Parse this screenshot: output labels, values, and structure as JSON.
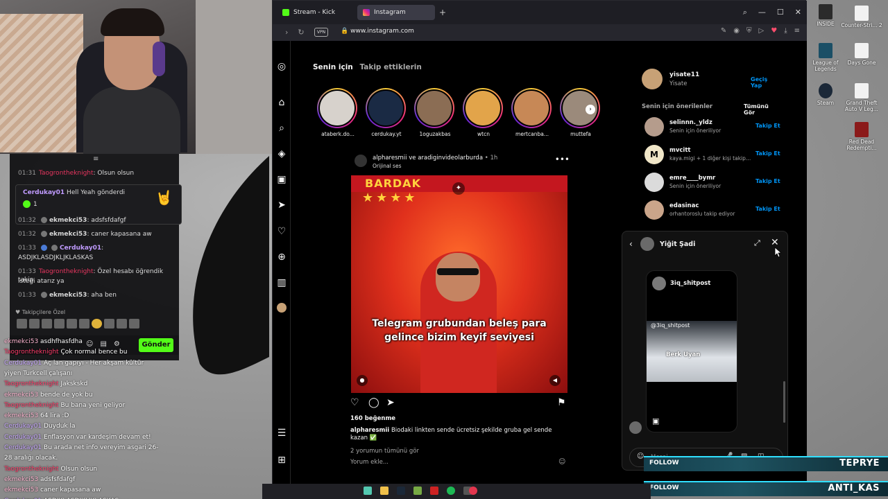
{
  "browser": {
    "tabs": [
      {
        "label": "Stream - Kick Dashboard",
        "icon": "kick-icon",
        "color": "#53fc18",
        "active": false
      },
      {
        "label": "Instagram",
        "icon": "instagram-icon",
        "color": "#e1306c",
        "active": true
      }
    ],
    "url": "www.instagram.com",
    "vpn_label": "VPN"
  },
  "feed": {
    "tab_active": "Senin için",
    "tab_inactive": "Takip ettiklerin",
    "stories": [
      {
        "name": "ataberk.do..."
      },
      {
        "name": "cerdukay.yt"
      },
      {
        "name": "1oguzakbas"
      },
      {
        "name": "wtcn"
      },
      {
        "name": "mertcanba..."
      },
      {
        "name": "muttefa"
      }
    ],
    "post": {
      "users": "alpharesmii ve aradiginvideolarburda",
      "time": "• 1h",
      "audio": "Orijinal ses",
      "banner": "BARDAK",
      "overlay_caption": "Telegram grubundan beleş para gelince bizim keyif seviyesi",
      "likes": "160 beğenme",
      "caption_user": "alpharesmii",
      "caption_text": "Biodaki linkten sende ücretsiz şekilde gruba gel sende kazan ✅",
      "view_comments": "2 yorumun tümünü gör",
      "add_comment": "Yorum ekle..."
    }
  },
  "sidebar": {
    "me": {
      "username": "yisate11",
      "name": "Yisate",
      "switch": "Geçiş Yap"
    },
    "suggestions_title": "Senin için önerilenler",
    "see_all": "Tümünü Gör",
    "suggestions": [
      {
        "name": "selinnn._yldz",
        "sub": "Senin için öneriliyor",
        "action": "Takip Et"
      },
      {
        "name": "mvcitt",
        "sub": "kaya.migi + 1 diğer kişi takip e...",
        "action": "Takip Et"
      },
      {
        "name": "emre____bymr",
        "sub": "Senin için öneriliyor",
        "action": "Takip Et"
      },
      {
        "name": "edasinac",
        "sub": "orhantoroslu takip ediyor",
        "action": "Takip Et"
      }
    ]
  },
  "dm": {
    "title": "Yiğit Şadi",
    "card_user": "3iq_shitpost",
    "card_inner_user": "@3iq_shitpost",
    "card_inner_name": "Berk Uyan",
    "input_placeholder": "Mesaj..."
  },
  "chat": {
    "lines": [
      {
        "time": "01:31",
        "user": "Taogrontheknight",
        "msg": ": Olsun olsun"
      },
      {
        "time": "01:32",
        "user": "ekmekci53",
        "msg": ": adsfsfdafgf"
      },
      {
        "time": "01:32",
        "user": "ekmekci53",
        "msg": ": caner kapasana aw"
      },
      {
        "time": "01:33",
        "user": "Cerdukay01",
        "msg": ":"
      },
      {
        "time": "",
        "user": "",
        "msg": "ASDJKLASDJKLJKLASKAS"
      },
      {
        "time": "01:33",
        "user": "Taogrontheknight",
        "msg": ": Özel hesabı öğrendik takip"
      },
      {
        "time": "",
        "user": "",
        "msg": "isteği atarız ya"
      },
      {
        "time": "01:33",
        "user": "ekmekci53",
        "msg": ": aha ben"
      }
    ],
    "highlight": {
      "user": "Cerdukay01",
      "msg": "Hell Yeah gönderdi",
      "count": "1"
    },
    "followers_label": "Takipçilere Özel",
    "send": "Gönder"
  },
  "overlay_chat": [
    {
      "user": "ekmekci53",
      "msg": "asdhfhasfdha"
    },
    {
      "user": "Taogrontheknight",
      "msg": "Çok normal bence bu"
    },
    {
      "user": "Cerdukay01",
      "msg": "Aç lan gapıyı - Her akşam kültür"
    },
    {
      "user": "",
      "msg": "yiyen Turkcell çalışanı"
    },
    {
      "user": "Taogrontheknight",
      "msg": "Jakskskd"
    },
    {
      "user": "ekmekci53",
      "msg": "bende de yok bu"
    },
    {
      "user": "Taogrontheknight",
      "msg": "Bu bana yeni geliyor"
    },
    {
      "user": "ekmekci53",
      "msg": "64 lira :D"
    },
    {
      "user": "Cerdukay01",
      "msg": "Duyduk la"
    },
    {
      "user": "Cerdukay01",
      "msg": "Enflasyon var kardeşim devam et!"
    },
    {
      "user": "Cerdukay01",
      "msg": "Bu arada net info vereyim asgari 26-"
    },
    {
      "user": "",
      "msg": "28 aralığı olacak."
    },
    {
      "user": "Taogrontheknight",
      "msg": "Olsun olsun"
    },
    {
      "user": "ekmekci53",
      "msg": "adsfsfdafgf"
    },
    {
      "user": "ekmekci53",
      "msg": "caner kapasana aw"
    },
    {
      "user": "Cerdukay01",
      "msg": "ASDJKLASDJKLJKLASKAS"
    }
  ],
  "desktop_icons": [
    {
      "label": "INSIDE"
    },
    {
      "label": "Counter-Stri... 2"
    },
    {
      "label": "League of Legends"
    },
    {
      "label": "Days Gone"
    },
    {
      "label": "Steam"
    },
    {
      "label": "Grand Theft Auto V Leg..."
    },
    {
      "label": "Red Dead Redempti..."
    }
  ],
  "follow_alerts": [
    {
      "tag": "FOLLOW",
      "name": "TEPRYE"
    },
    {
      "tag": "FOLLOW",
      "name": "ANTI_KAS"
    }
  ],
  "colors": {
    "kick_green": "#53fc18",
    "ig_blue": "#0095f6",
    "accent_cyan": "#30e0ff"
  }
}
